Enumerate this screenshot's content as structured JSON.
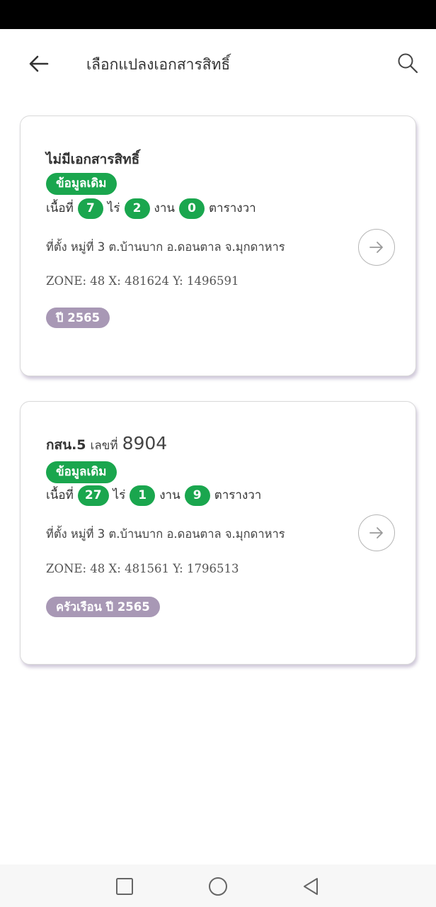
{
  "app": {
    "title": "เลือกแปลงเอกสารสิทธิ์"
  },
  "colors": {
    "accent_green": "#1aa64e",
    "year_badge": "#a898b5"
  },
  "cards": [
    {
      "heading": "ไม่มีเอกสารสิทธิ์",
      "tag": "ข้อมูลเดิม",
      "area_label": "เนื้อที่",
      "rai": "7",
      "rai_unit": "ไร่",
      "ngan": "2",
      "ngan_unit": "งาน",
      "wa": "0",
      "wa_unit": "ตารางวา",
      "location": "ที่ตั้ง หมู่ที่ 3 ต.บ้านบาก อ.ดอนตาล จ.มุกดาหาร",
      "zone": "ZONE: 48  X: 481624  Y: 1496591",
      "year_badge": "ปี 2565"
    },
    {
      "heading": "กสน.5",
      "heading_mid": "เลขที่",
      "heading_number": "8904",
      "tag": "ข้อมูลเดิม",
      "area_label": "เนื้อที่",
      "rai": "27",
      "rai_unit": "ไร่",
      "ngan": "1",
      "ngan_unit": "งาน",
      "wa": "9",
      "wa_unit": "ตารางวา",
      "location": "ที่ตั้ง หมู่ที่ 3 ต.บ้านบาก อ.ดอนตาล จ.มุกดาหาร",
      "zone": "ZONE: 48  X: 481561  Y: 1796513",
      "year_badge": "ครัวเรือน ปี 2565"
    }
  ],
  "icons": {
    "back": "arrow-left",
    "search": "magnifier",
    "card_open": "arrow-right-circle",
    "nav_recents": "square",
    "nav_home": "circle",
    "nav_back": "triangle-left"
  }
}
